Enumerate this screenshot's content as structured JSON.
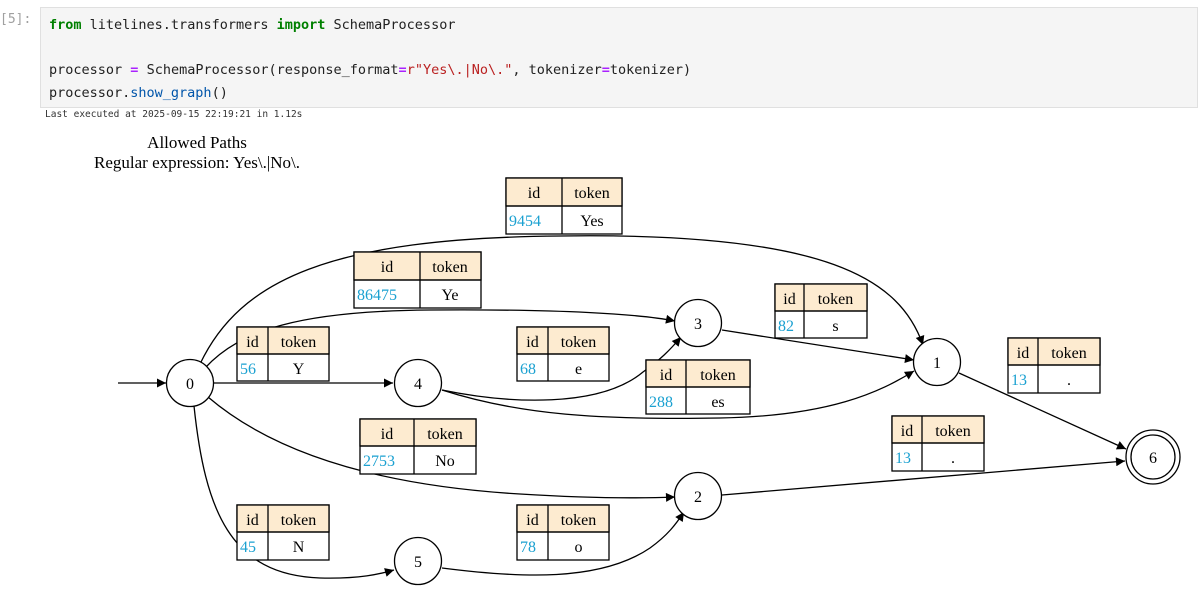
{
  "cell": {
    "prompt": "[5]:",
    "code": {
      "line1": {
        "kw_from": "from",
        "module": "litelines.transformers",
        "kw_import": "import",
        "name": "SchemaProcessor"
      },
      "line2": {
        "var": "processor",
        "eq": "=",
        "call": "SchemaProcessor(response_format",
        "eq2": "=",
        "str": "r\"Yes\\.|No\\.\"",
        "mid": ", tokenizer",
        "eq3": "=",
        "end": "tokenizer)"
      },
      "line3": {
        "obj": "processor.",
        "method": "show_graph",
        "end": "()"
      }
    },
    "last_executed": "Last executed at 2025-09-15 22:19:21 in 1.12s"
  },
  "graph": {
    "title": "Allowed Paths",
    "subtitle": "Regular expression: Yes\\.|No\\.",
    "header_id": "id",
    "header_token": "token",
    "nodes": [
      "0",
      "1",
      "2",
      "3",
      "4",
      "5",
      "6"
    ],
    "edges": [
      {
        "from": "0",
        "to": "1",
        "id": "9454",
        "token": "Yes"
      },
      {
        "from": "0",
        "to": "3",
        "id": "86475",
        "token": "Ye"
      },
      {
        "from": "0",
        "to": "4",
        "id": "56",
        "token": "Y"
      },
      {
        "from": "0",
        "to": "2",
        "id": "2753",
        "token": "No"
      },
      {
        "from": "0",
        "to": "5",
        "id": "45",
        "token": "N"
      },
      {
        "from": "4",
        "to": "3",
        "id": "68",
        "token": "e"
      },
      {
        "from": "4",
        "to": "1",
        "id": "288",
        "token": "es"
      },
      {
        "from": "3",
        "to": "1",
        "id": "82",
        "token": "s"
      },
      {
        "from": "5",
        "to": "2",
        "id": "78",
        "token": "o"
      },
      {
        "from": "1",
        "to": "6",
        "id": "13",
        "token": "."
      },
      {
        "from": "2",
        "to": "6",
        "id": "13",
        "token": "."
      }
    ],
    "colors": {
      "header_bg": "#fdebd0",
      "id_text": "#1ba1d1",
      "stroke": "#000000"
    }
  }
}
